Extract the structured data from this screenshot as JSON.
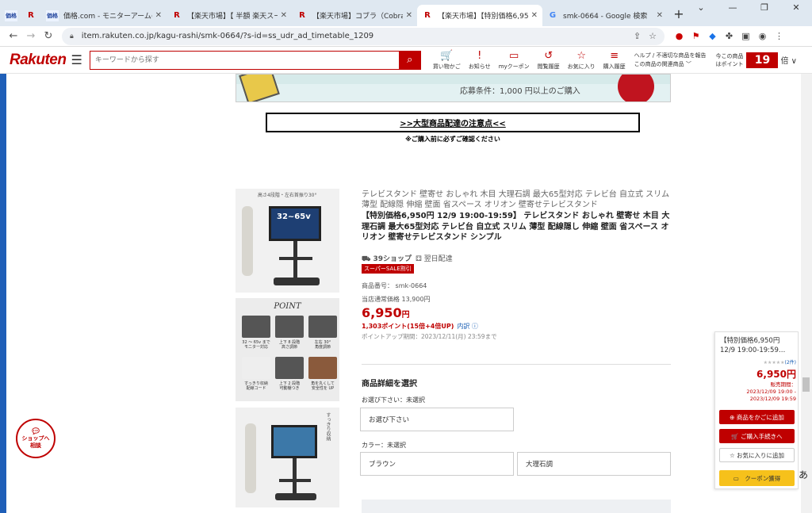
{
  "browser": {
    "tabs": [
      {
        "favicon": "kakaku",
        "title": "",
        "narrow": true
      },
      {
        "favicon": "R",
        "title": "",
        "narrow": true
      },
      {
        "favicon": "kakaku",
        "title": "価格.com - モニターアームのクチコミ掲"
      },
      {
        "favicon": "R",
        "title": "【楽天市場】【 半額 楽天スーパーSAL"
      },
      {
        "favicon": "R",
        "title": "【楽天市場】コブラ（Cobra）（メンズ"
      },
      {
        "favicon": "R",
        "title": "【楽天市場】【特別価格6,950円 12/"
      },
      {
        "favicon": "G",
        "title": "smk-0664 - Google 検索"
      }
    ],
    "new_tab": "+",
    "window_controls": [
      "⌄",
      "—",
      "❐",
      "✕"
    ],
    "url": "item.rakuten.co.jp/kagu-rashi/smk-0664/?s-id=ss_udr_ad_timetable_1209"
  },
  "header": {
    "logo": "Rakuten",
    "search_placeholder": "キーワードから探す",
    "icons": [
      {
        "icon": "cart-icon",
        "glyph": "🛒",
        "label": "買い物かご"
      },
      {
        "icon": "notice-icon",
        "glyph": "!",
        "label": "お知らせ"
      },
      {
        "icon": "coupon-icon",
        "glyph": "▭",
        "label": "myクーポン"
      },
      {
        "icon": "history-icon",
        "glyph": "↺",
        "label": "閲覧履歴"
      },
      {
        "icon": "star-icon",
        "glyph": "☆",
        "label": "お気に入り"
      },
      {
        "icon": "purchase-icon",
        "glyph": "≡",
        "label": "購入履歴"
      }
    ],
    "help_line1": "ヘルプ / 不適切な商品を報告",
    "help_line2": "この商品の関連商品 ﹀",
    "points_line1": "今この商品",
    "points_line2": "はポイント",
    "points_multiplier": "19",
    "points_suffix": "倍 ∨"
  },
  "banner": {
    "condition": "応募条件：1,000 円以上のご購入"
  },
  "notice": {
    "link": ">>大型商品配達の注意点<<",
    "sub": "※ご購入前に必ずご確認ください"
  },
  "thumbs": {
    "t1_caption": "高さ4段階・左右首振り30°",
    "t1_size": "32~65v",
    "t2_title": "POINT",
    "t2_labels": [
      "32 ～ 65v まで\nモニター対応",
      "上下 8 段階\n高さ調節",
      "左右 30°\n角度調節",
      "すっきり収納\n配線コード",
      "上下 2 段階\n可動棚つき",
      "角を丸くして\n安全性を UP"
    ],
    "t3_caption": "すっきり収納"
  },
  "product": {
    "category_title": "テレビスタンド 壁寄せ おしゃれ 木目 大理石調 最大65型対応 テレビ台 自立式 スリム 薄型 配線隠 伸縮 壁面 省スペース オリオン 壁寄せテレビスタンド",
    "name": "【特別価格6,950円 12/9 19:00-19:59】 テレビスタンド おしゃれ 壁寄せ 木目 大理石調 最大65型対応 テレビ台 自立式 スリム 薄型 配線隠し 伸縮 壁面 省スペース オリオン 壁寄せテレビスタンド シンプル",
    "shop_39": "⛟ 39ショップ",
    "next_day": "⚃ 翌日配達",
    "sale_badge": "スーパーSALE割引",
    "item_number": "商品番号： smk-0664",
    "normal_price": "当店通常価格 13,900円",
    "price": "6,950",
    "price_unit": "円",
    "points": "1,303ポイント(15倍+4倍UP)",
    "points_link": "内訳 ⓘ",
    "points_period": "ポイントアップ期間：2023/12/11(月) 23:59まで"
  },
  "selection": {
    "title": "商品詳細を選択",
    "label1": "お選び下さい：未選択",
    "box1": "お選び下さい",
    "label2": "カラー：未選択",
    "color_options": [
      "ブラウン",
      "大理石調"
    ]
  },
  "chat": {
    "label": "ショップへ\n相談"
  },
  "side_panel": {
    "title_line1": "【特別価格6,950円",
    "title_line2": "12/9 19:00-19:59…",
    "stars": "★★★★★",
    "reviews": "(2件)",
    "price": "6,950円",
    "period_label": "販売期間：",
    "period_from": "2023/12/09 19:00 -",
    "period_to": "2023/12/09 19:59",
    "cart_btn": "⊕ 商品をかごに追加",
    "buy_btn": "🛒 ご購入手続きへ",
    "fav_btn": "☆ お気に入りに追加",
    "coupon_btn": "▭　クーポン獲得"
  },
  "ime": "あ"
}
